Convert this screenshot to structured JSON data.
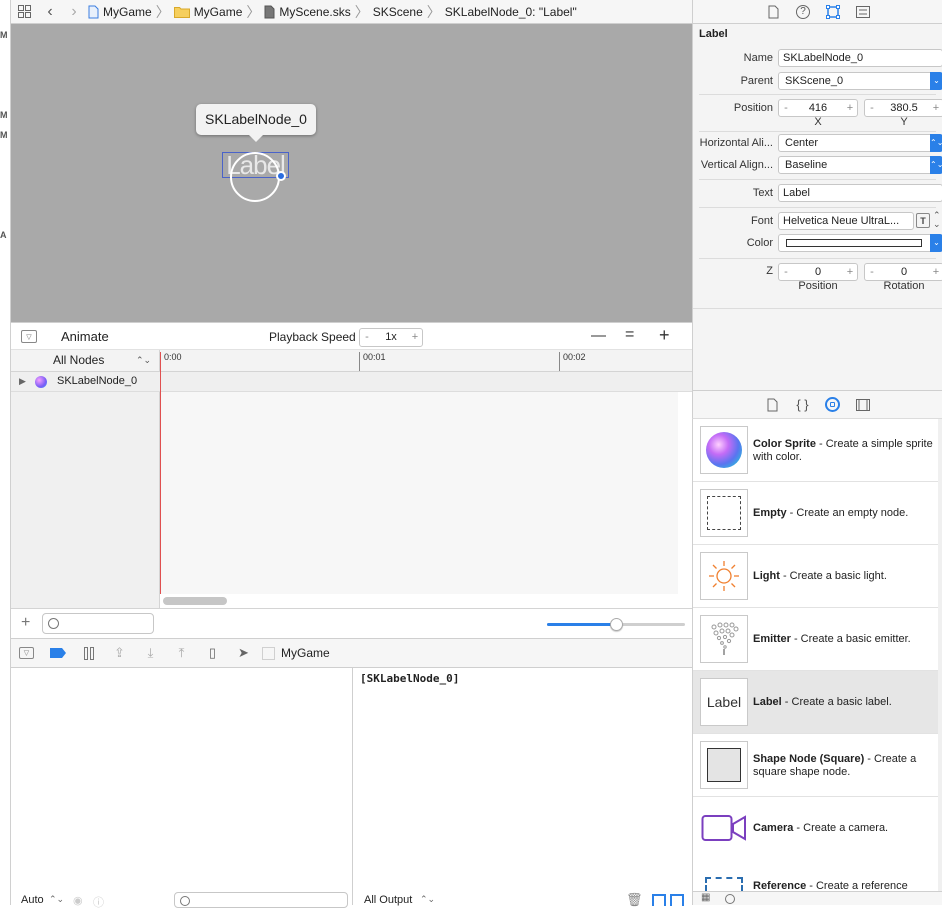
{
  "jumpbar": {
    "crumbs": [
      "MyGame",
      "MyGame",
      "MyScene.sks",
      "SKScene",
      "SKLabelNode_0: \"Label\""
    ]
  },
  "gutter": [
    "M",
    "M",
    "M",
    "A"
  ],
  "canvas": {
    "tooltip": "SKLabelNode_0",
    "label_text": "Label",
    "background": "#a9a9a9"
  },
  "action_editor": {
    "animate_label": "Animate",
    "playback_speed_label": "Playback Speed",
    "playback_speed_value": "1x",
    "zoom_minus": "—",
    "zoom_equal": "=",
    "zoom_plus": "+",
    "filter_label": "All Nodes",
    "ticks": [
      "0:00",
      "00:01",
      "00:02"
    ],
    "node_name": "SKLabelNode_0",
    "timeline_slider_fraction": 0.5
  },
  "debug_area": {
    "target": "MyGame",
    "console_output": "[SKLabelNode_0]",
    "auto_label": "Auto",
    "output_label": "All Output"
  },
  "inspector": {
    "section_title": "Label",
    "name_label": "Name",
    "name_value": "SKLabelNode_0",
    "parent_label": "Parent",
    "parent_value": "SKScene_0",
    "position_label": "Position",
    "position_x": "416",
    "position_y": "380.5",
    "x_label": "X",
    "y_label": "Y",
    "halign_label": "Horizontal Ali...",
    "halign_value": "Center",
    "valign_label": "Vertical Align...",
    "valign_value": "Baseline",
    "text_label": "Text",
    "text_value": "Label",
    "font_label": "Font",
    "font_value": "Helvetica Neue UltraL...",
    "color_label": "Color",
    "z_label": "Z",
    "z_position": "0",
    "z_rotation": "0",
    "zpos_sub": "Position",
    "zrot_sub": "Rotation",
    "accent": "#2a80e8"
  },
  "library": {
    "items": [
      {
        "title": "Color Sprite",
        "desc": " - Create a simple sprite with color.",
        "icon": "color-sprite-icon"
      },
      {
        "title": "Empty",
        "desc": " - Create an empty node.",
        "icon": "empty-node-icon"
      },
      {
        "title": "Light",
        "desc": " - Create a basic light.",
        "icon": "light-icon"
      },
      {
        "title": "Emitter",
        "desc": " - Create a basic emitter.",
        "icon": "emitter-icon"
      },
      {
        "title": "Label",
        "desc": " - Create a basic label.",
        "icon": "label-icon",
        "thumb_text": "Label"
      },
      {
        "title": "Shape Node (Square)",
        "desc": " - Create a square shape node.",
        "icon": "shape-node-icon"
      },
      {
        "title": "Camera",
        "desc": " - Create a camera.",
        "icon": "camera-icon"
      },
      {
        "title": "Reference",
        "desc": " - Create a reference",
        "icon": "reference-icon"
      }
    ]
  }
}
